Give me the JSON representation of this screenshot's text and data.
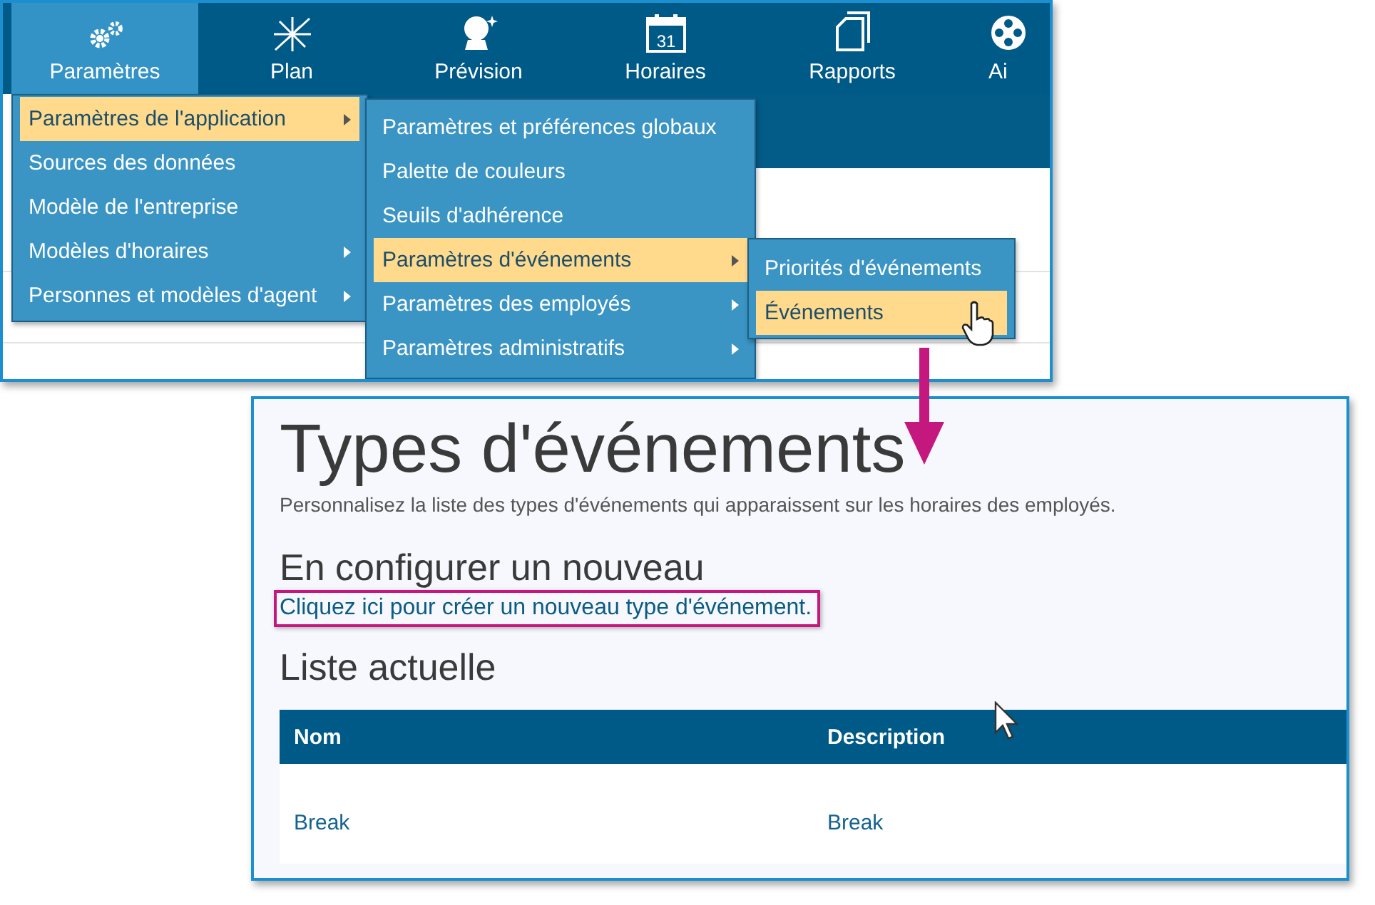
{
  "top_screenshot": {
    "nav": [
      {
        "label": "Paramètres",
        "kind": "gears",
        "selected": true
      },
      {
        "label": "Plan",
        "kind": "compass",
        "selected": false
      },
      {
        "label": "Prévision",
        "kind": "crystal-ball",
        "selected": false
      },
      {
        "label": "Horaires",
        "kind": "calendar",
        "calendar_day": "31",
        "selected": false
      },
      {
        "label": "Rapports",
        "kind": "documents",
        "selected": false
      },
      {
        "label": "Ai",
        "kind": "film-reel",
        "selected": false
      }
    ],
    "menu": [
      {
        "label": "Paramètres de l'application",
        "has_submenu": true,
        "selected": true,
        "children": [
          {
            "label": "Paramètres et préférences globaux",
            "has_submenu": false,
            "selected": false
          },
          {
            "label": "Palette de couleurs",
            "has_submenu": false,
            "selected": false
          },
          {
            "label": "Seuils d'adhérence",
            "has_submenu": false,
            "selected": false
          },
          {
            "label": "Paramètres d'événements",
            "has_submenu": true,
            "selected": true,
            "children": [
              {
                "label": "Priorités d'événements",
                "has_submenu": false,
                "selected": false
              },
              {
                "label": "Événements",
                "has_submenu": false,
                "selected": true
              }
            ]
          },
          {
            "label": "Paramètres des employés",
            "has_submenu": true,
            "selected": false
          },
          {
            "label": "Paramètres administratifs",
            "has_submenu": true,
            "selected": false
          }
        ]
      },
      {
        "label": "Sources des données",
        "has_submenu": false,
        "selected": false
      },
      {
        "label": "Modèle de l'entreprise",
        "has_submenu": false,
        "selected": false
      },
      {
        "label": "Modèles d'horaires",
        "has_submenu": true,
        "selected": false
      },
      {
        "label": "Personnes et modèles d'agent",
        "has_submenu": true,
        "selected": false
      }
    ]
  },
  "bottom_screenshot": {
    "title": "Types d'événements",
    "description": "Personnalisez la liste des types d'événements qui apparaissent sur les horaires des employés.",
    "new_heading": "En configurer un nouveau",
    "new_link": "Cliquez ici pour créer un nouveau type d'événement.",
    "list_heading": "Liste actuelle",
    "table": {
      "columns": [
        "Nom",
        "Description"
      ],
      "rows": [
        [
          "Break",
          "Break"
        ]
      ]
    }
  }
}
